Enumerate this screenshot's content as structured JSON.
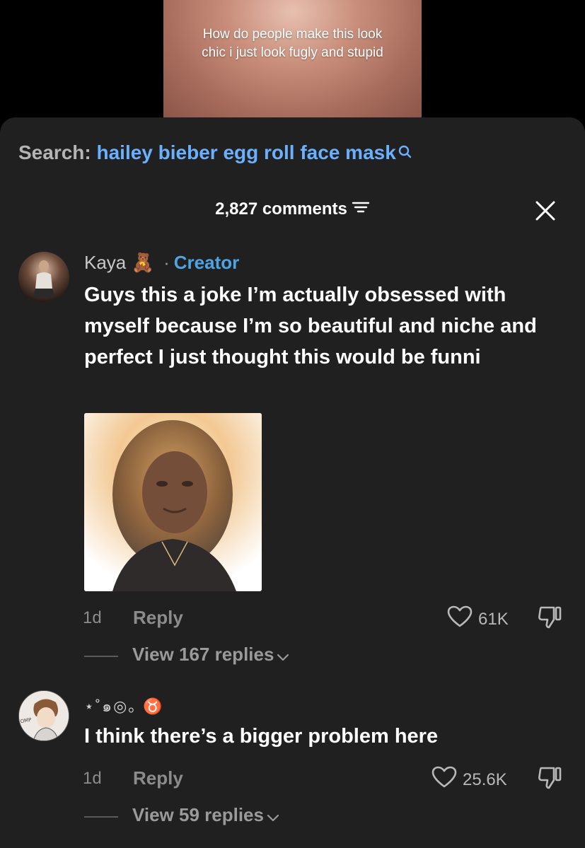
{
  "video": {
    "caption": "How do people make this look chic i just look fugly and stupid"
  },
  "search": {
    "label": "Search:",
    "query": "hailey bieber egg roll face mask"
  },
  "comments_header": {
    "count_text": "2,827 comments"
  },
  "comments": [
    {
      "username": "Kaya",
      "emoji": "🧸",
      "separator": "·",
      "badge": "Creator",
      "text": "Guys this a joke I’m actually obsessed with myself because I’m so beautiful and niche and perfect I just thought this would be funni",
      "time": "1d",
      "reply_label": "Reply",
      "likes": "61K",
      "view_replies": "View 167 replies"
    },
    {
      "username": "⋆˚๑◎｡ ♉",
      "text": "I think there’s a bigger problem here",
      "time": "1d",
      "reply_label": "Reply",
      "likes": "25.6K",
      "view_replies": "View 59 replies"
    }
  ],
  "colors": {
    "background": "#000000",
    "sheet": "#202020",
    "link_blue": "#6ab0ff",
    "creator_blue": "#4ea3e0",
    "muted_gray": "#8c8c8c"
  },
  "icons": [
    "search-icon",
    "filter-icon",
    "close-icon",
    "heart-icon",
    "dislike-icon",
    "chevron-down-icon"
  ]
}
